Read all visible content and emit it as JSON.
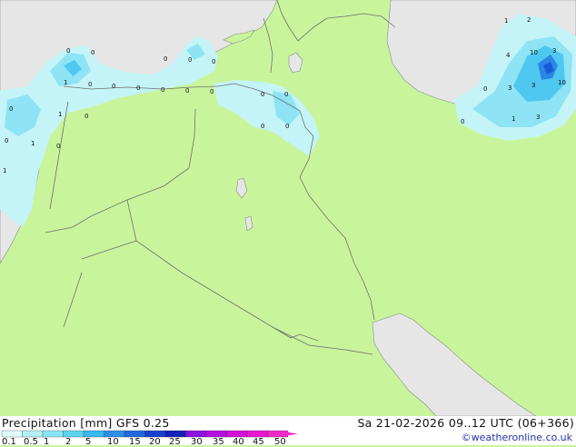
{
  "title": "Precipitation [mm]  GFS 0.25",
  "datetime": "Sa 21-02-2026 09..12 UTC (06+366)",
  "credit": "©weatheronline.co.uk",
  "legend": {
    "ticks": [
      "0.1",
      "0.5",
      "1",
      "2",
      "5",
      "10",
      "15",
      "20",
      "25",
      "30",
      "35",
      "40",
      "45",
      "50"
    ],
    "colors": [
      "#e0fcfc",
      "#b4f0f8",
      "#88e4f4",
      "#5cd4f0",
      "#38b8ec",
      "#2c90e4",
      "#2068dc",
      "#1840d0",
      "#1020b8",
      "#8c10e0",
      "#b410e0",
      "#d410d8",
      "#e818d0",
      "#f028c8"
    ]
  },
  "map_labels": [
    "0",
    "0",
    "0",
    "0",
    "0",
    "1",
    "0",
    "0",
    "0",
    "0",
    "0",
    "0",
    "0",
    "0",
    "1",
    "0",
    "0",
    "0",
    "1",
    "0",
    "0",
    "0",
    "1",
    "1",
    "2",
    "4",
    "10",
    "3",
    "10",
    "3",
    "0",
    "3",
    "1",
    "3",
    "0"
  ],
  "colors": {
    "land": "#c8f59b",
    "sea": "#e6e6e6",
    "border": "#707070",
    "precip_light": "#c4f4f8",
    "precip_mid": "#8ee4f4",
    "precip_strong": "#4ec8f0",
    "precip_heavy": "#2c86e4"
  }
}
